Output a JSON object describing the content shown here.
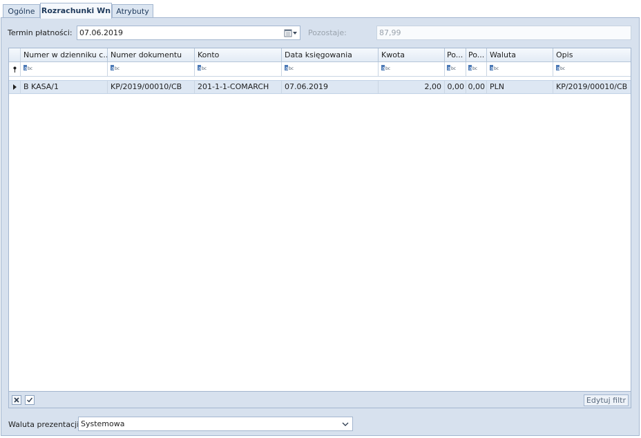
{
  "tabs": [
    {
      "label": "Ogólne"
    },
    {
      "label": "Rozrachunki Wn"
    },
    {
      "label": "Atrybuty"
    }
  ],
  "form": {
    "due_date_label": "Termin płatności:",
    "due_date_value": "07.06.2019",
    "remaining_label": "Pozostaje:",
    "remaining_value": "87,99"
  },
  "grid": {
    "columns": [
      "Numer w dzienniku c...",
      "Numer dokumentu",
      "Konto",
      "Data księgowania",
      "Kwota",
      "Po...",
      "Po...",
      "Waluta",
      "Opis"
    ],
    "rows": [
      [
        "B KASA/1",
        "KP/2019/00010/CB",
        "201-1-1-COMARCH",
        "07.06.2019",
        "2,00",
        "0,00",
        "0,00",
        "PLN",
        "KP/2019/00010/CB"
      ]
    ],
    "edit_filter_label": "Edytuj filtr"
  },
  "presentation": {
    "label": "Waluta prezentacji",
    "value": "Systemowa"
  },
  "icons": {
    "calendar": "calendar-icon",
    "filter_row": "filter-row-icon",
    "row_indicator": "row-pointer-icon",
    "clear_filter": "close-icon",
    "filter_enabled": "checkbox-check-icon",
    "dropdown": "chevron-down-icon"
  },
  "colors": {
    "panel_bg": "#d7e1ee",
    "border": "#a3b6cf",
    "selected_row": "#dde7f3"
  }
}
